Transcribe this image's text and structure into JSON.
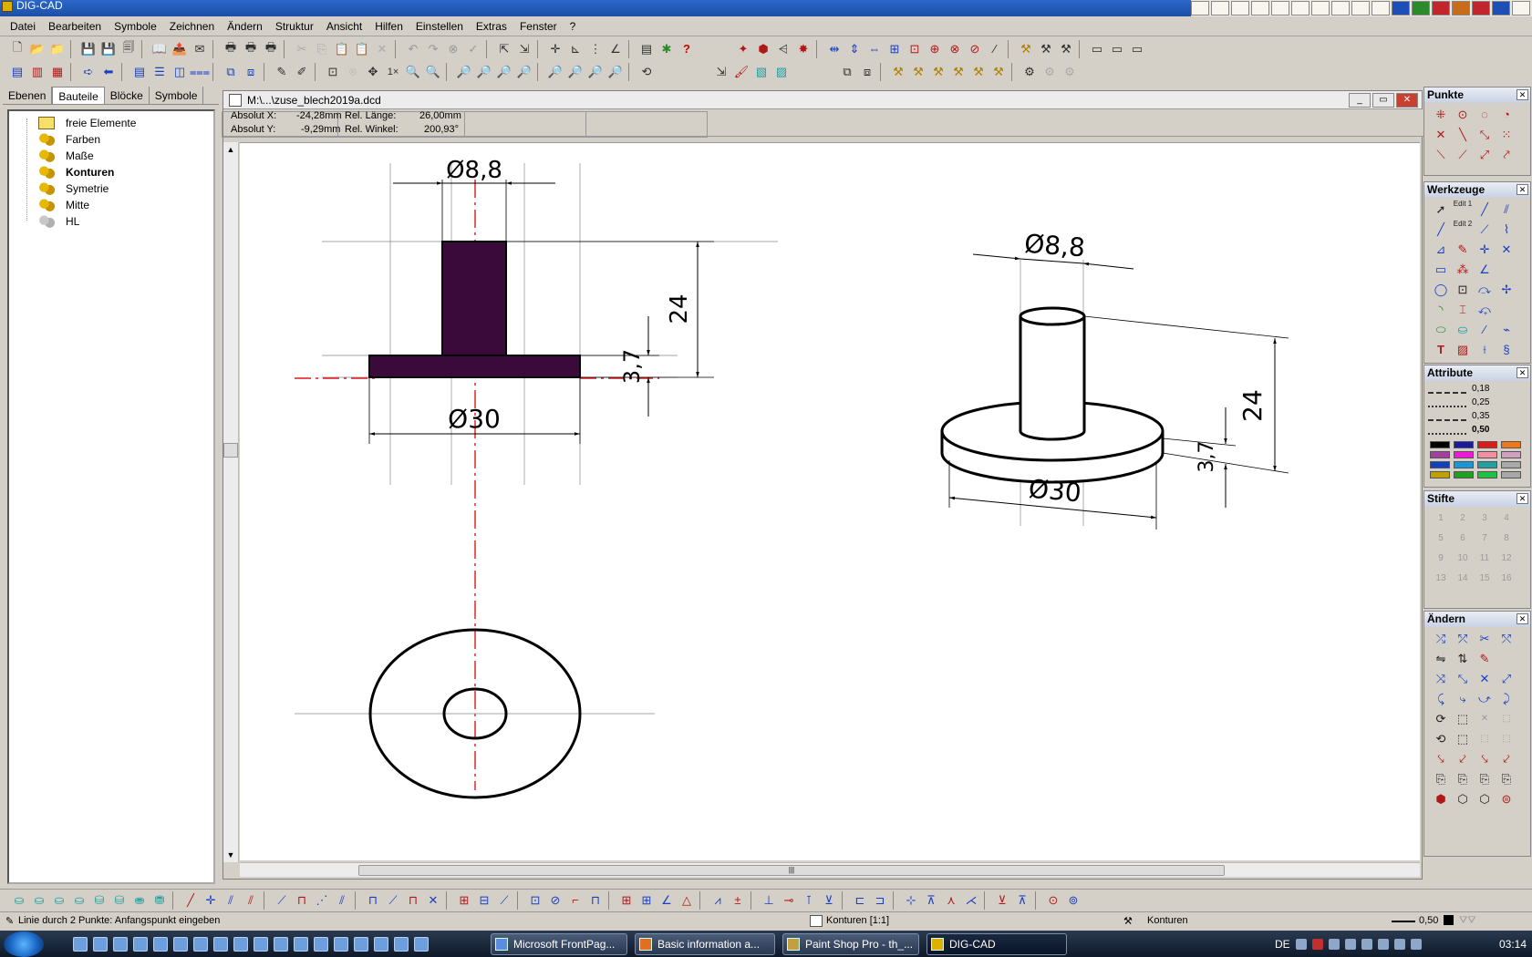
{
  "app": {
    "title": "DIG-CAD"
  },
  "menu": [
    "Datei",
    "Bearbeiten",
    "Symbole",
    "Zeichnen",
    "Ändern",
    "Struktur",
    "Ansicht",
    "Hilfen",
    "Einstellen",
    "Extras",
    "Fenster",
    "?"
  ],
  "left_panel": {
    "tabs": [
      "Ebenen",
      "Bauteile",
      "Blöcke",
      "Symbole"
    ],
    "active_tab": "Bauteile",
    "tree": [
      "freie Elemente",
      "Farben",
      "Maße",
      "Konturen",
      "Symetrie",
      "Mitte",
      "HL"
    ]
  },
  "drawing": {
    "title": "M:\\...\\zuse_blech2019a.dcd",
    "coords": {
      "abs_x_label": "Absolut X:",
      "abs_x": "-24,28mm",
      "abs_y_label": "Absolut Y:",
      "abs_y": "-9,29mm",
      "rel_len_label": "Rel. Länge:",
      "rel_len": "26,00mm",
      "rel_angle_label": "Rel. Winkel:",
      "rel_angle": "200,93°"
    },
    "dims": {
      "top_dia": "Ø8,8",
      "height": "24",
      "thick": "3,7",
      "base_dia": "Ø30",
      "iso_top_dia": "Ø8,8",
      "iso_height": "24",
      "iso_base_dia": "Ø30"
    }
  },
  "palettes": {
    "punkte": "Punkte",
    "werkzeuge": "Werkzeuge",
    "attribute": "Attribute",
    "stifte": "Stifte",
    "aendern": "Ändern",
    "edit1": "Edit 1",
    "edit2": "Edit 2",
    "line_widths": [
      "0,18",
      "0,25",
      "0,35",
      "0,50"
    ],
    "colors": [
      "#000000",
      "#1a1aa0",
      "#e01818",
      "#f07818",
      "#a040a0",
      "#f018d8",
      "#f090a0",
      "#d0a0c0",
      "#1040c0",
      "#1898d8",
      "#20a0a0",
      "#a8a8a8",
      "#c0a000",
      "#20a020",
      "#20c040",
      "#a8a8a8"
    ],
    "pen_numbers": [
      "1",
      "2",
      "3",
      "4",
      "5",
      "6",
      "7",
      "8",
      "9",
      "10",
      "11",
      "12",
      "13",
      "14",
      "15",
      "16"
    ]
  },
  "status": {
    "message": "Linie durch 2 Punkte: Anfangspunkt eingeben",
    "layer": "Konturen [1:1]",
    "component": "Konturen",
    "line_width": "0,50"
  },
  "taskbar": {
    "tasks": [
      "Microsoft FrontPag...",
      "Basic information a...",
      "Paint Shop Pro - th_...",
      "DIG-CAD"
    ],
    "lang": "DE",
    "clock": "03:14"
  }
}
